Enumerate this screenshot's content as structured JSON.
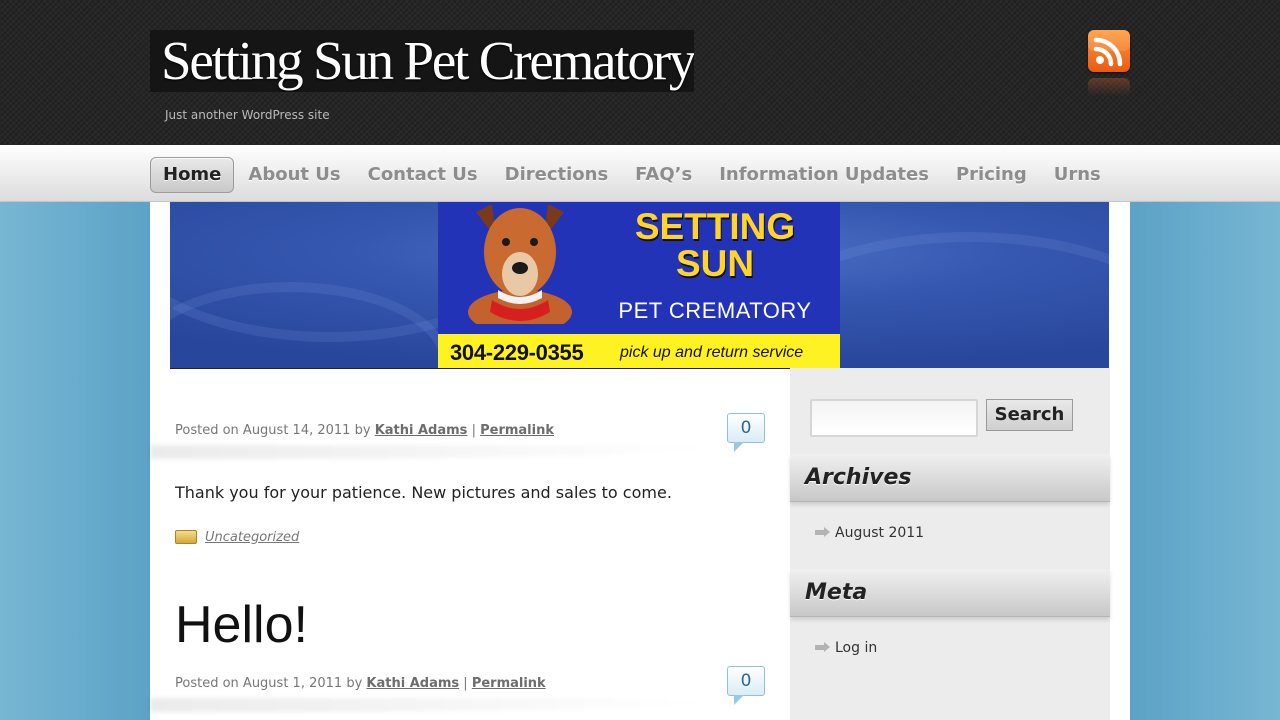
{
  "header": {
    "site_title": "Setting Sun Pet Crematory",
    "tagline": "Just another WordPress site",
    "rss_icon": "rss-icon"
  },
  "nav": {
    "items": [
      {
        "label": "Home",
        "active": true
      },
      {
        "label": "About Us",
        "active": false
      },
      {
        "label": "Contact Us",
        "active": false
      },
      {
        "label": "Directions",
        "active": false
      },
      {
        "label": "FAQ’s",
        "active": false
      },
      {
        "label": "Information Updates",
        "active": false
      },
      {
        "label": "Pricing",
        "active": false
      },
      {
        "label": "Urns",
        "active": false
      }
    ]
  },
  "banner": {
    "sign_title_line1": "SETTING",
    "sign_title_line2": "SUN",
    "sign_subtitle": "PET CREMATORY",
    "phone": "304-229-0355",
    "service": "pick up and return service"
  },
  "posts": [
    {
      "posted_on_prefix": "Posted on",
      "date": "August 14, 2011",
      "by": "by",
      "author": "Kathi Adams",
      "separator": "|",
      "permalink": "Permalink",
      "comments": "0",
      "body": "Thank you for your patience. New pictures and sales to come.",
      "category": "Uncategorized"
    },
    {
      "title": "Hello!",
      "posted_on_prefix": "Posted on",
      "date": "August 1, 2011",
      "by": "by",
      "author": "Kathi Adams",
      "separator": "|",
      "permalink": "Permalink",
      "comments": "0"
    }
  ],
  "sidebar": {
    "search_value": "",
    "search_button": "Search",
    "archives_title": "Archives",
    "archives": [
      "August 2011"
    ],
    "meta_title": "Meta",
    "meta_links": [
      "Log in"
    ]
  },
  "colors": {
    "header_bg": "#262626",
    "page_bg": "#4f98c0",
    "rss_orange": "#f07a24",
    "comment_blue": "#34648a"
  }
}
